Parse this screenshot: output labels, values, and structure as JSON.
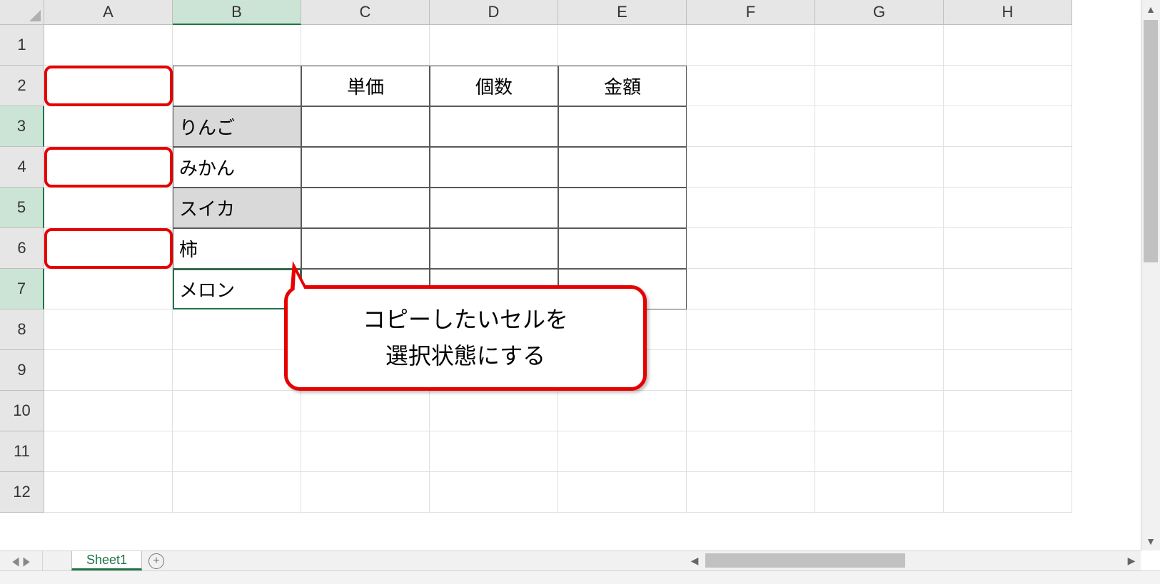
{
  "columns": [
    "A",
    "B",
    "C",
    "D",
    "E",
    "F",
    "G",
    "H"
  ],
  "rows": [
    "1",
    "2",
    "3",
    "4",
    "5",
    "6",
    "7",
    "8",
    "9",
    "10",
    "11",
    "12"
  ],
  "activeColumn": "B",
  "activeRows": [
    "3",
    "5",
    "7"
  ],
  "tableHeaders": {
    "C2": "単価",
    "D2": "個数",
    "E2": "金額"
  },
  "tableItems": {
    "B3": "りんご",
    "B4": "みかん",
    "B5": "スイカ",
    "B6": "柿",
    "B7": "メロン"
  },
  "selectedCells": [
    "B3",
    "B5"
  ],
  "activeCell": "B7",
  "callout": {
    "line1": "コピーしたいセルを",
    "line2": "選択状態にする"
  },
  "sheetTab": "Sheet1"
}
